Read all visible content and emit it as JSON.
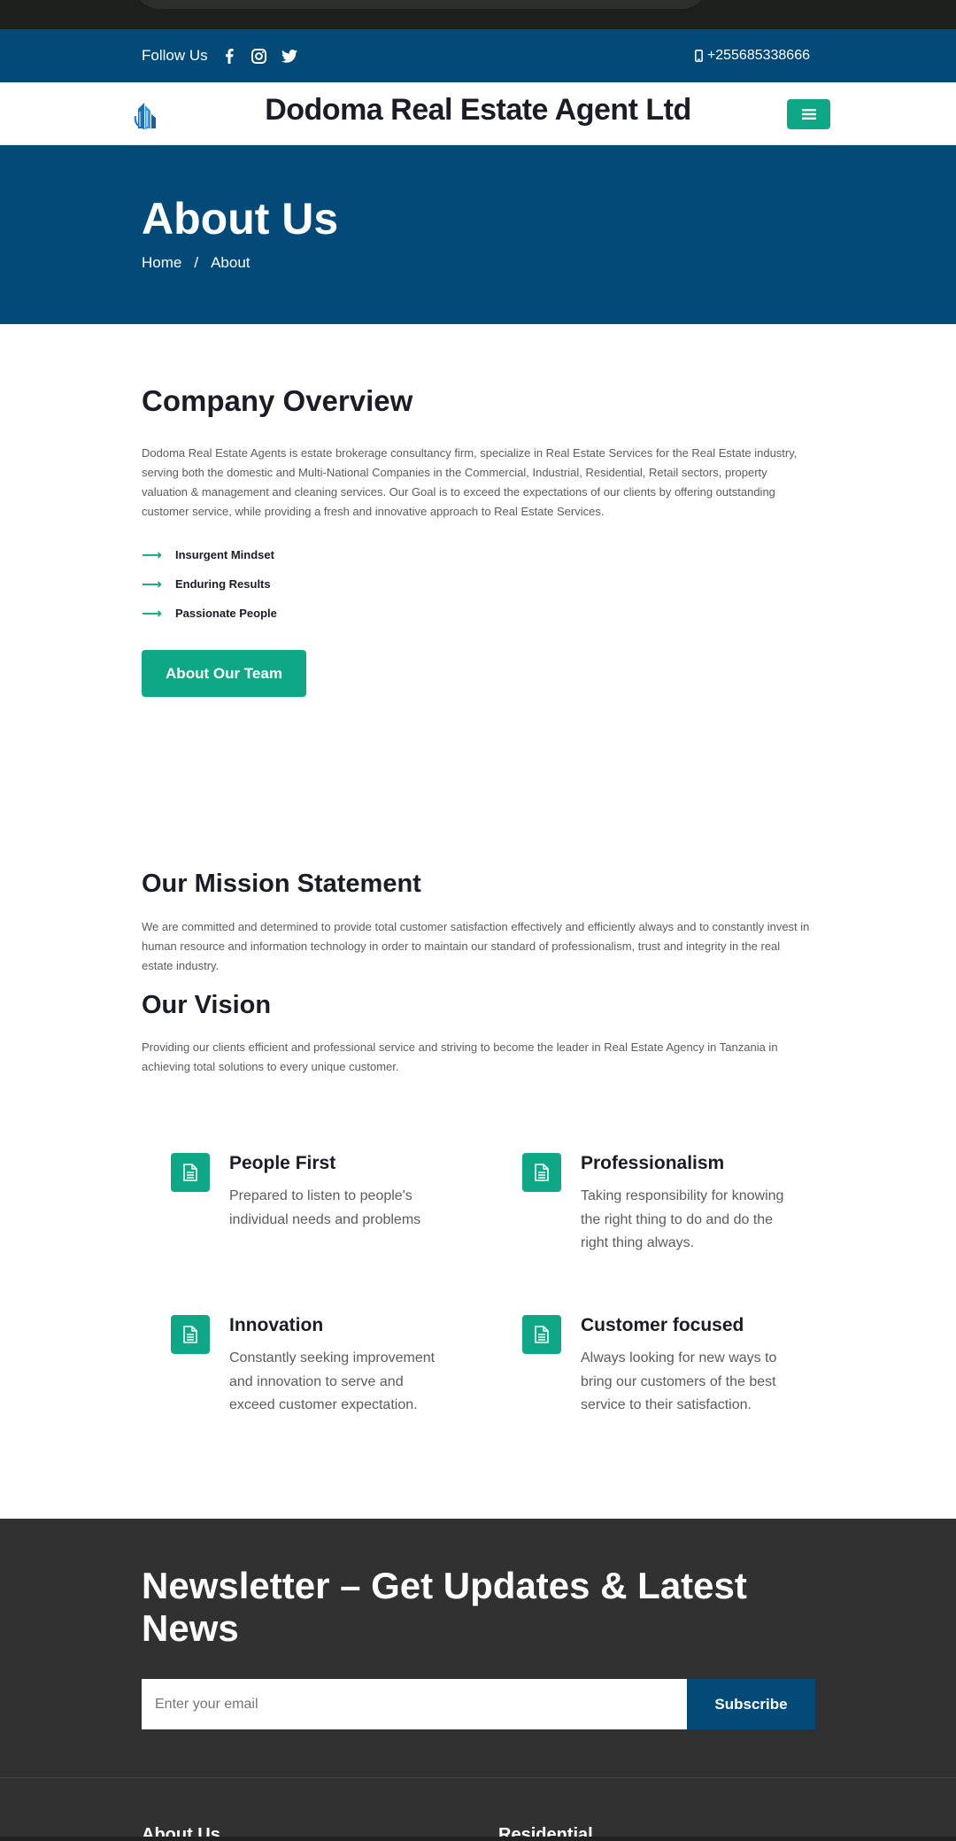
{
  "topbar": {
    "follow_label": "Follow Us",
    "social_icons": [
      "facebook-icon",
      "instagram-icon",
      "twitter-icon"
    ],
    "phone": "+255685338666"
  },
  "header": {
    "brand": "Dodoma Real Estate Agent Ltd"
  },
  "hero": {
    "title": "About Us",
    "breadcrumb": [
      "Home",
      "/",
      "About"
    ]
  },
  "overview": {
    "title": "Company Overview",
    "text": "Dodoma Real Estate Agents is estate brokerage consultancy firm, specialize in Real Estate Services for the Real Estate industry, serving both the domestic and Multi-National Companies in the Commercial, Industrial, Residential, Retail sectors, property valuation & management and cleaning services. Our Goal is to exceed the expectations of our clients by offering outstanding customer service, while providing a fresh and innovative approach to Real Estate Services.",
    "features": [
      "Insurgent Mindset",
      "Enduring Results",
      "Passionate People"
    ],
    "button_label": "About Our Team"
  },
  "mission": {
    "title": "Our Mission Statement",
    "text": "We are committed and determined to provide total customer satisfaction effectively and efficiently always and to constantly invest in human resource and information technology in order to maintain our standard of professionalism, trust and integrity in the real estate industry."
  },
  "vision": {
    "title": "Our Vision",
    "text": "Providing our clients efficient and professional service and striving to become the leader in Real Estate Agency in Tanzania in achieving total solutions to every unique customer."
  },
  "values": [
    {
      "title": "People First",
      "text": "Prepared to listen to people's individual needs and problems"
    },
    {
      "title": "Professionalism",
      "text": "Taking responsibility for knowing the right thing to do and do the right thing always."
    },
    {
      "title": "Innovation",
      "text": "Constantly seeking improvement and innovation to serve and exceed customer expectation."
    },
    {
      "title": "Customer focused",
      "text": "Always looking for new ways to bring our customers of the best service to their satisfaction."
    }
  ],
  "newsletter": {
    "title": "Newsletter – Get Updates & Latest News",
    "placeholder": "Enter your email",
    "button_label": "Subscribe"
  },
  "footer": {
    "col1": "About Us",
    "col2": "Residential"
  },
  "colors": {
    "primary_blue": "#034a78",
    "accent_green": "#0fa886",
    "dark": "#313131"
  }
}
